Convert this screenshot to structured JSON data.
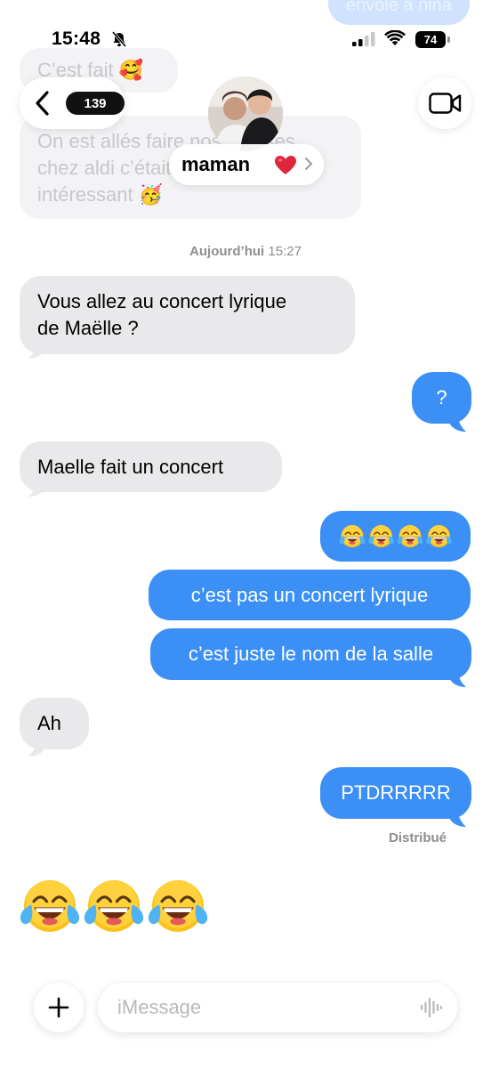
{
  "status_bar": {
    "time": "15:48",
    "battery": "74"
  },
  "header": {
    "back_count": "139",
    "contact_name": "maman",
    "contact_emoji": "heart"
  },
  "faded_messages": {
    "outgoing_top": "envoie à nina",
    "incoming_1": "C’est fait 🥰",
    "incoming_2_line1": "On est allés faire nos courses",
    "incoming_2_line2": "chez aldi c’était",
    "incoming_2_line3": "intéressant 🥳"
  },
  "timestamp": {
    "day": "Aujourd’hui",
    "time": "15:27"
  },
  "messages": [
    {
      "direction": "in",
      "line1": "Vous allez au concert lyrique",
      "line2": "de Maëlle ?"
    },
    {
      "direction": "out",
      "text": "?"
    },
    {
      "direction": "in",
      "text": "Maelle fait un concert"
    },
    {
      "direction": "out",
      "emoji": "😂😂😂😂"
    },
    {
      "direction": "out",
      "text": "c’est pas un concert lyrique"
    },
    {
      "direction": "out",
      "text": "c’est juste le nom de la salle"
    },
    {
      "direction": "in",
      "text": "Ah"
    },
    {
      "direction": "out",
      "text": "PTDRRRRR"
    },
    {
      "direction": "in",
      "emoji": "😂😂😂"
    }
  ],
  "delivery_status": "Distribué",
  "composer": {
    "placeholder": "iMessage"
  },
  "colors": {
    "outgoing": "#3b8ff5",
    "incoming": "#e9e9eb",
    "secondary_text": "#8e8e93"
  }
}
